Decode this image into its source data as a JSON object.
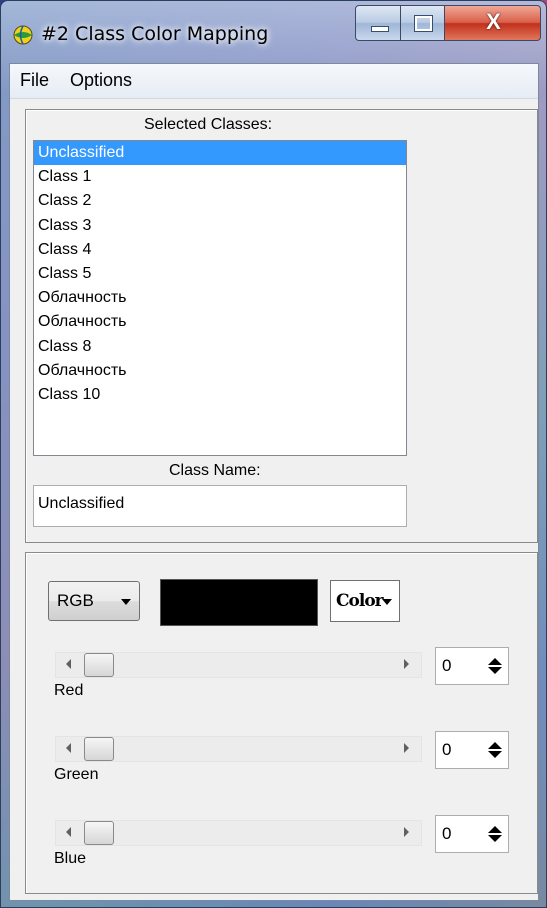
{
  "window": {
    "title": "#2 Class Color Mapping"
  },
  "menu": {
    "file": "File",
    "options": "Options"
  },
  "classes": {
    "header": "Selected Classes:",
    "items": [
      "Unclassified",
      "Class 1",
      "Class 2",
      "Class 3",
      "Class 4",
      "Class 5",
      "Облачность",
      "Облачность",
      "Class 8",
      "Облачность",
      "Class 10"
    ],
    "selected_index": 0
  },
  "class_name": {
    "label": "Class Name:",
    "value": "Unclassified"
  },
  "color": {
    "mode": "RGB",
    "button_label": "Color",
    "swatch": "#000000",
    "channels": [
      {
        "label": "Red",
        "value": "0"
      },
      {
        "label": "Green",
        "value": "0"
      },
      {
        "label": "Blue",
        "value": "0"
      }
    ]
  },
  "colors": {
    "selection": "#3399ff",
    "close_button": "#c2301c"
  }
}
